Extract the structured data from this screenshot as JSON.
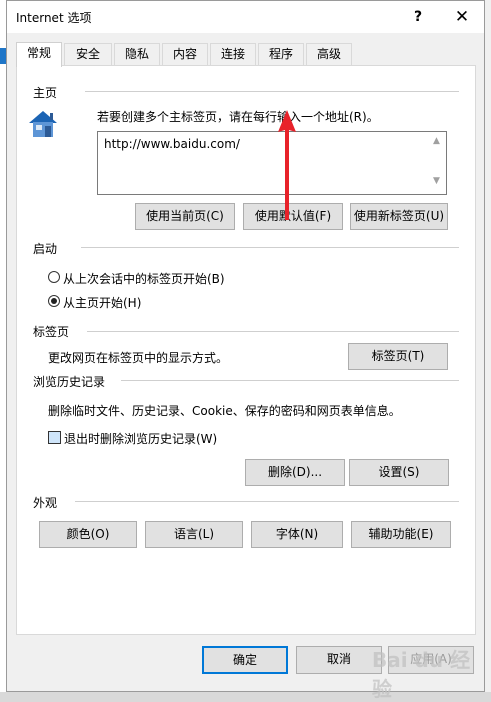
{
  "window": {
    "title": "Internet 选项",
    "help_glyph": "?",
    "close_glyph": "✕"
  },
  "tabs": [
    {
      "label": "常规",
      "active": true
    },
    {
      "label": "安全"
    },
    {
      "label": "隐私"
    },
    {
      "label": "内容"
    },
    {
      "label": "连接"
    },
    {
      "label": "程序"
    },
    {
      "label": "高级"
    }
  ],
  "homepage": {
    "section_title": "主页",
    "instruction": "若要创建多个主标签页，请在每行输入一个地址(R)。",
    "url_value": "http://www.baidu.com/",
    "buttons": {
      "use_current": "使用当前页(C)",
      "use_default": "使用默认值(F)",
      "use_new_tab": "使用新标签页(U)"
    }
  },
  "startup": {
    "section_title": "启动",
    "option_last_session": "从上次会话中的标签页开始(B)",
    "option_homepage": "从主页开始(H)",
    "selected": "homepage"
  },
  "tabs_section": {
    "section_title": "标签页",
    "description": "更改网页在标签页中的显示方式。",
    "button": "标签页(T)"
  },
  "history": {
    "section_title": "浏览历史记录",
    "description": "删除临时文件、历史记录、Cookie、保存的密码和网页表单信息。",
    "checkbox_label": "退出时删除浏览历史记录(W)",
    "checked": false,
    "delete_button": "删除(D)...",
    "settings_button": "设置(S)"
  },
  "appearance": {
    "section_title": "外观",
    "buttons": {
      "colors": "颜色(O)",
      "languages": "语言(L)",
      "fonts": "字体(N)",
      "accessibility": "辅助功能(E)"
    }
  },
  "footer": {
    "ok": "确定",
    "cancel": "取消",
    "apply": "应用(A)"
  },
  "watermark": "Bai du 经验",
  "colors": {
    "accent": "#0078d7",
    "arrow": "#e8222a",
    "house_roof": "#1c64b4"
  }
}
